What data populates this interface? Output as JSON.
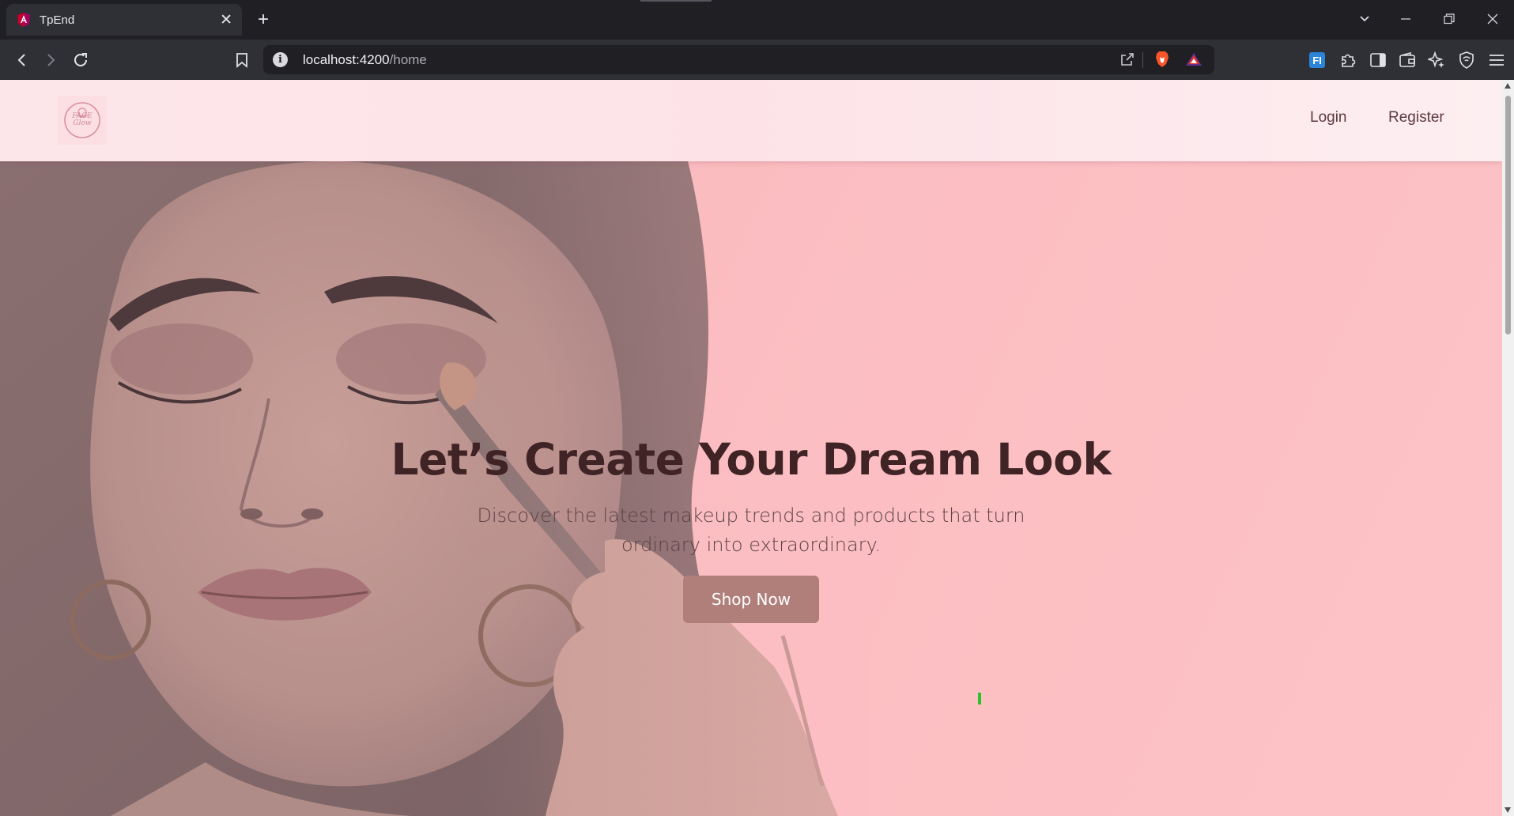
{
  "browser": {
    "tab": {
      "title": "TpEnd",
      "favicon": "angular-icon",
      "close_glyph": "✕"
    },
    "new_tab_glyph": "+",
    "window_controls": {
      "tab_search_glyph": "⌄",
      "minimize_glyph": "—",
      "restore_glyph": "❐",
      "close_glyph": "✕"
    },
    "url": {
      "host": "localhost:4200",
      "path": "/home"
    },
    "toolbar_icons": [
      "back-icon",
      "forward-icon",
      "reload-icon",
      "bookmark-icon",
      "site-info-icon",
      "share-icon",
      "brave-shields-icon",
      "brave-rewards-icon",
      "fi-extension-icon",
      "extensions-icon",
      "sidebar-icon",
      "wallet-icon",
      "leo-ai-icon",
      "vpn-icon",
      "menu-icon"
    ]
  },
  "page": {
    "navbar": {
      "logo_text": "FACE\nGlow",
      "links": [
        {
          "label": "Login"
        },
        {
          "label": "Register"
        }
      ]
    },
    "hero": {
      "title": "Let’s Create Your Dream Look",
      "subtitle": "Discover the latest makeup trends and products that turn ordinary into extraordinary.",
      "cta_label": "Shop Now"
    }
  },
  "colors": {
    "chrome_bg": "#1f1f24",
    "toolbar_bg": "#2f2f36",
    "hero_pink": "#fcc0c4",
    "navbar_pink": "#fde6ea",
    "title_color": "#3f2325",
    "cta_bg": "#b07f7a"
  }
}
